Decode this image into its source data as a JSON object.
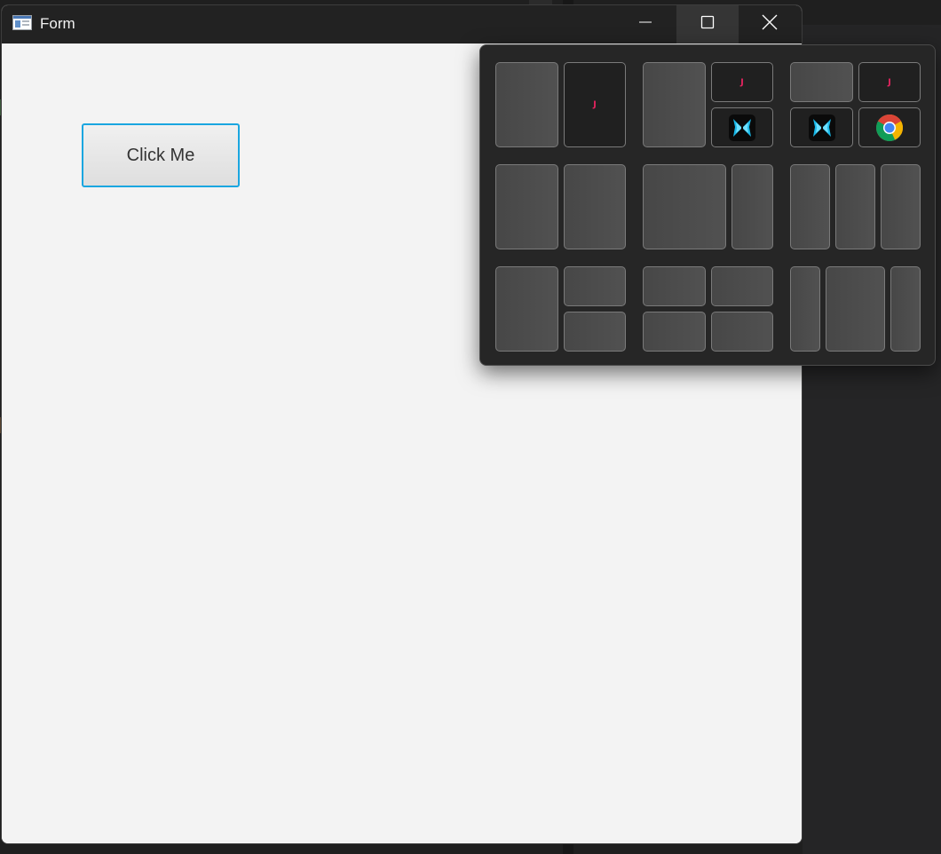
{
  "window": {
    "title": "Form",
    "caption": {
      "minimize": "minimize-icon",
      "maximize": "maximize-icon",
      "close": "close-icon"
    }
  },
  "form": {
    "button_label": "Click Me"
  },
  "snap_flyout": {
    "layout_count": 9,
    "app_icons": {
      "j_app": "J",
      "butterfly_app": "butterfly-icon",
      "chrome_app": "chrome-icon"
    }
  },
  "colors": {
    "titlebar": "#222222",
    "client_bg": "#f3f3f3",
    "button_border": "#1aa6e0",
    "flyout_bg": "#262626",
    "zone_border": "#7a7a7a",
    "j_color": "#e0245e"
  }
}
